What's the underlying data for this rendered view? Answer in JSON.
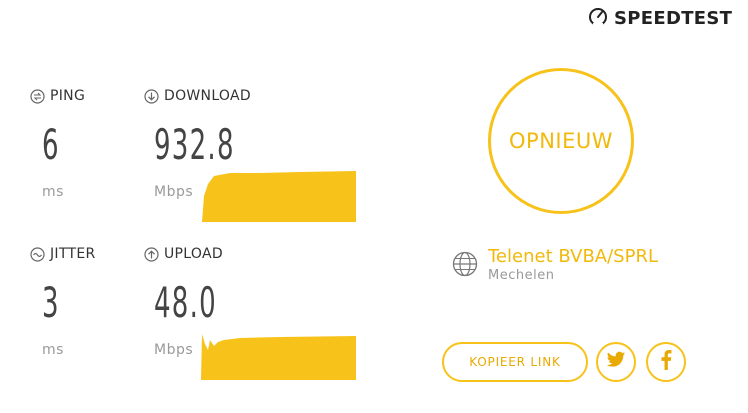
{
  "brand": {
    "name": "SPEEDTEST",
    "icon": "speedometer-icon"
  },
  "metrics": {
    "ping": {
      "label": "PING",
      "value": "6",
      "unit": "ms",
      "icon": "ping-icon"
    },
    "download": {
      "label": "DOWNLOAD",
      "value": "932.8",
      "unit": "Mbps",
      "icon": "download-icon"
    },
    "jitter": {
      "label": "JITTER",
      "value": "3",
      "unit": "ms",
      "icon": "jitter-icon"
    },
    "upload": {
      "label": "UPLOAD",
      "value": "48.0",
      "unit": "Mbps",
      "icon": "upload-icon"
    }
  },
  "restart": {
    "label": "OPNIEUW"
  },
  "provider": {
    "name": "Telenet BVBA/SPRL",
    "location": "Mechelen",
    "icon": "globe-icon"
  },
  "share": {
    "copy_label": "KOPIEER LINK",
    "twitter_icon": "twitter-icon",
    "facebook_icon": "facebook-icon"
  },
  "colors": {
    "accent": "#f7c21a",
    "accent_text": "#f0b90b",
    "muted": "#9a9a9a"
  }
}
